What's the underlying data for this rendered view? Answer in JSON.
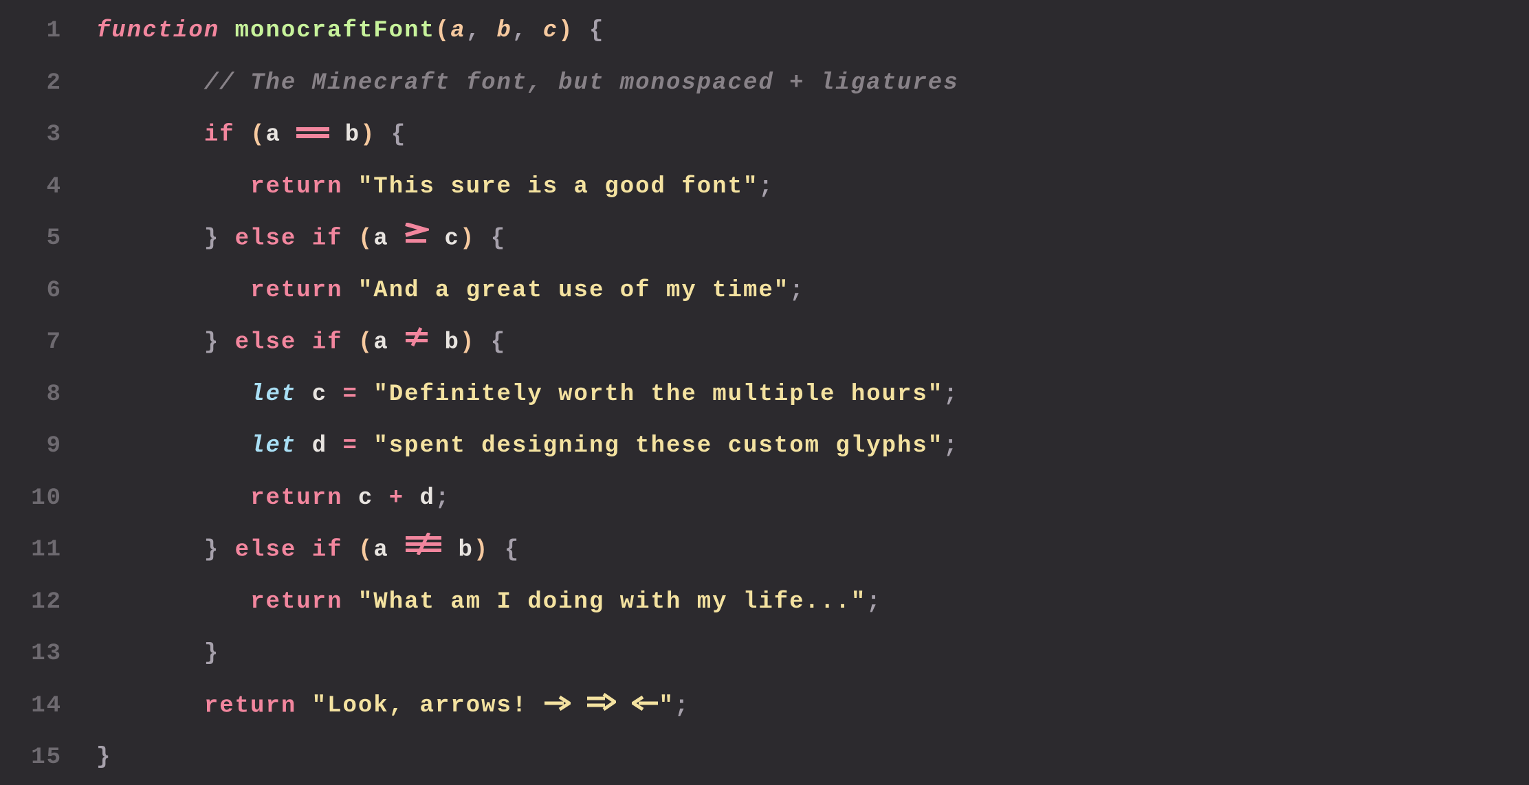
{
  "colors": {
    "background": "#2c2a2e",
    "gutter": "#6e6a70",
    "guide": "#45414a",
    "keyword": "#f2869e",
    "function_name": "#c7f29b",
    "paren_param": "#f6c99f",
    "punct": "#a6a0ab",
    "comment": "#888288",
    "let": "#a9dff5",
    "identifier": "#e8e4e0",
    "string": "#f4e2a0"
  },
  "gutter": {
    "l1": "1",
    "l2": "2",
    "l3": "3",
    "l4": "4",
    "l5": "5",
    "l6": "6",
    "l7": "7",
    "l8": "8",
    "l9": "9",
    "l10": "10",
    "l11": "11",
    "l12": "12",
    "l13": "13",
    "l14": "14",
    "l15": "15"
  },
  "tok": {
    "function": "function",
    "fn_name": "monocraftFont",
    "paren_open": "(",
    "paren_close": ")",
    "a": "a",
    "b": "b",
    "c": "c",
    "d": "d",
    "comma": ",",
    "space": " ",
    "brace_open": "{",
    "brace_close": "}",
    "comment_line": "// The Minecraft font, but monospaced + ligatures",
    "if": "if",
    "else": "else",
    "return": "return",
    "let": "let",
    "eq_assign": "=",
    "plus": "+",
    "semi": ";",
    "op_eqeq": "==",
    "op_gte": ">=",
    "op_neq": "!=",
    "op_neqeq": "!==",
    "str_q": "\"",
    "str1": "This sure is a good font",
    "str2": "And a great use of my time",
    "str3": "Definitely worth the multiple hours",
    "str4": "spent designing these custom glyphs",
    "str5": "What am I doing with my life...",
    "str6a": "Look, arrows! ",
    "arrow_right": "->",
    "arrow_fat": "=>",
    "arrow_left": "<-",
    "indent1": "    ",
    "indent2": "        ",
    "guide_indent1": "   ",
    "guide_indent2": "       "
  }
}
